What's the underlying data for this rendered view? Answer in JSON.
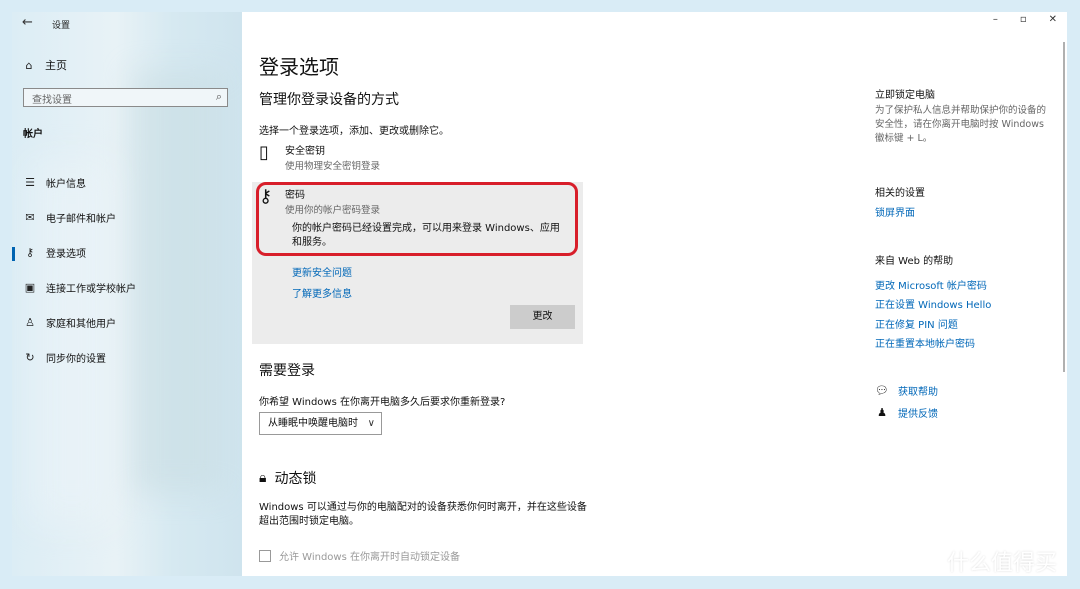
{
  "window": {
    "title": "设置",
    "controls": [
      "–",
      "▫",
      "✕"
    ]
  },
  "sidebar": {
    "home": "主页",
    "search_placeholder": "查找设置",
    "section": "帐户",
    "items": [
      {
        "icon": "user-card-icon",
        "label": "帐户信息"
      },
      {
        "icon": "mail-icon",
        "label": "电子邮件和帐户"
      },
      {
        "icon": "key-icon",
        "label": "登录选项",
        "active": true
      },
      {
        "icon": "briefcase-icon",
        "label": "连接工作或学校帐户"
      },
      {
        "icon": "person-icon",
        "label": "家庭和其他用户"
      },
      {
        "icon": "sync-icon",
        "label": "同步你的设置"
      }
    ]
  },
  "main": {
    "page_title": "登录选项",
    "manage_heading": "管理你登录设备的方式",
    "choose_desc": "选择一个登录选项，添加、更改或删除它。",
    "security_key": {
      "title": "安全密钥",
      "subtitle": "使用物理安全密钥登录"
    },
    "password": {
      "title": "密码",
      "subtitle": "使用你的帐户密码登录",
      "message": "你的帐户密码已经设置完成，可以用来登录 Windows、应用和服务。",
      "link_security": "更新安全问题",
      "link_learn": "了解更多信息",
      "change_button": "更改"
    },
    "require_heading": "需要登录",
    "require_question": "你希望 Windows 在你离开电脑多久后要求你重新登录?",
    "require_value": "从睡眠中唤醒电脑时",
    "dynamic_lock_heading": "动态锁",
    "dynamic_lock_desc": "Windows 可以通过与你的电脑配对的设备获悉你何时离开，并在这些设备超出范围时锁定电脑。",
    "dynamic_lock_checkbox": "允许 Windows 在你离开时自动锁定设备"
  },
  "right": {
    "lock_title": "立即锁定电脑",
    "lock_desc": "为了保护私人信息并帮助保护你的设备的安全性，请在你离开电脑时按 Windows 徽标键 + L。",
    "related_title": "相关的设置",
    "related_link": "锁屏界面",
    "web_help_title": "来自 Web 的帮助",
    "web_links": [
      "更改 Microsoft 帐户密码",
      "正在设置 Windows Hello",
      "正在修复 PIN 问题",
      "正在重置本地帐户密码"
    ],
    "get_help": "获取帮助",
    "feedback": "提供反馈"
  },
  "watermark": "什么值得买"
}
